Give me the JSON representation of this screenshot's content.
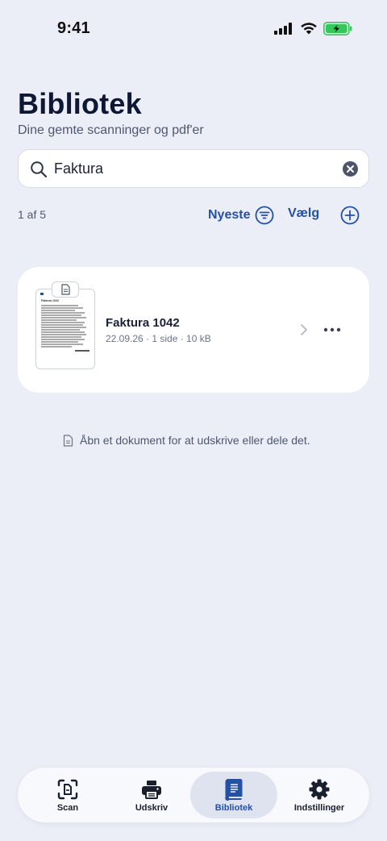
{
  "status_bar": {
    "time": "9:41"
  },
  "header": {
    "title": "Bibliotek",
    "subtitle": "Dine gemte scanninger og pdf'er"
  },
  "search": {
    "value": "Faktura",
    "icon": "search-icon",
    "clear_icon": "clear-icon"
  },
  "toolbar": {
    "result_count": "1 af 5",
    "sort_label": "Nyeste",
    "select_label": "Vælg"
  },
  "documents": [
    {
      "name": "Faktura 1042",
      "meta": "22.09.26 · 1 side · 10 kB",
      "thumb_title": "Faktura 1042"
    }
  ],
  "hint": {
    "text": "Åbn et dokument for at udskrive eller dele det."
  },
  "tab_bar": {
    "tabs": [
      {
        "label": "Scan",
        "icon": "scan-icon"
      },
      {
        "label": "Udskriv",
        "icon": "printer-icon"
      },
      {
        "label": "Bibliotek",
        "icon": "book-icon",
        "active": true
      },
      {
        "label": "Indstillinger",
        "icon": "gear-icon"
      }
    ]
  },
  "colors": {
    "background": "#ebedf7",
    "accent": "#2451a6",
    "title": "#0e1834",
    "battery": "#34c759"
  }
}
